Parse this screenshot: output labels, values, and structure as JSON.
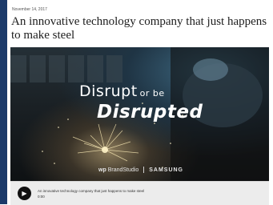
{
  "article": {
    "date": "November 14, 2017",
    "headline": "An innovative technology company that just happens to make steel"
  },
  "video": {
    "title_line1_big": "Disrupt",
    "title_line1_small": "or be",
    "title_line2": "Disrupted",
    "brand": "WP BrandStudio",
    "brand_prefix": "wp",
    "brand_suffix": "BrandStudio",
    "sponsor": "SAMSUNG"
  },
  "player": {
    "title": "An innovative technology company that just happens to make steel",
    "time": "0:00",
    "play_icon": "play-icon"
  },
  "colors": {
    "left_stripe": "#1b3a6a",
    "player_bg": "#ececec"
  }
}
